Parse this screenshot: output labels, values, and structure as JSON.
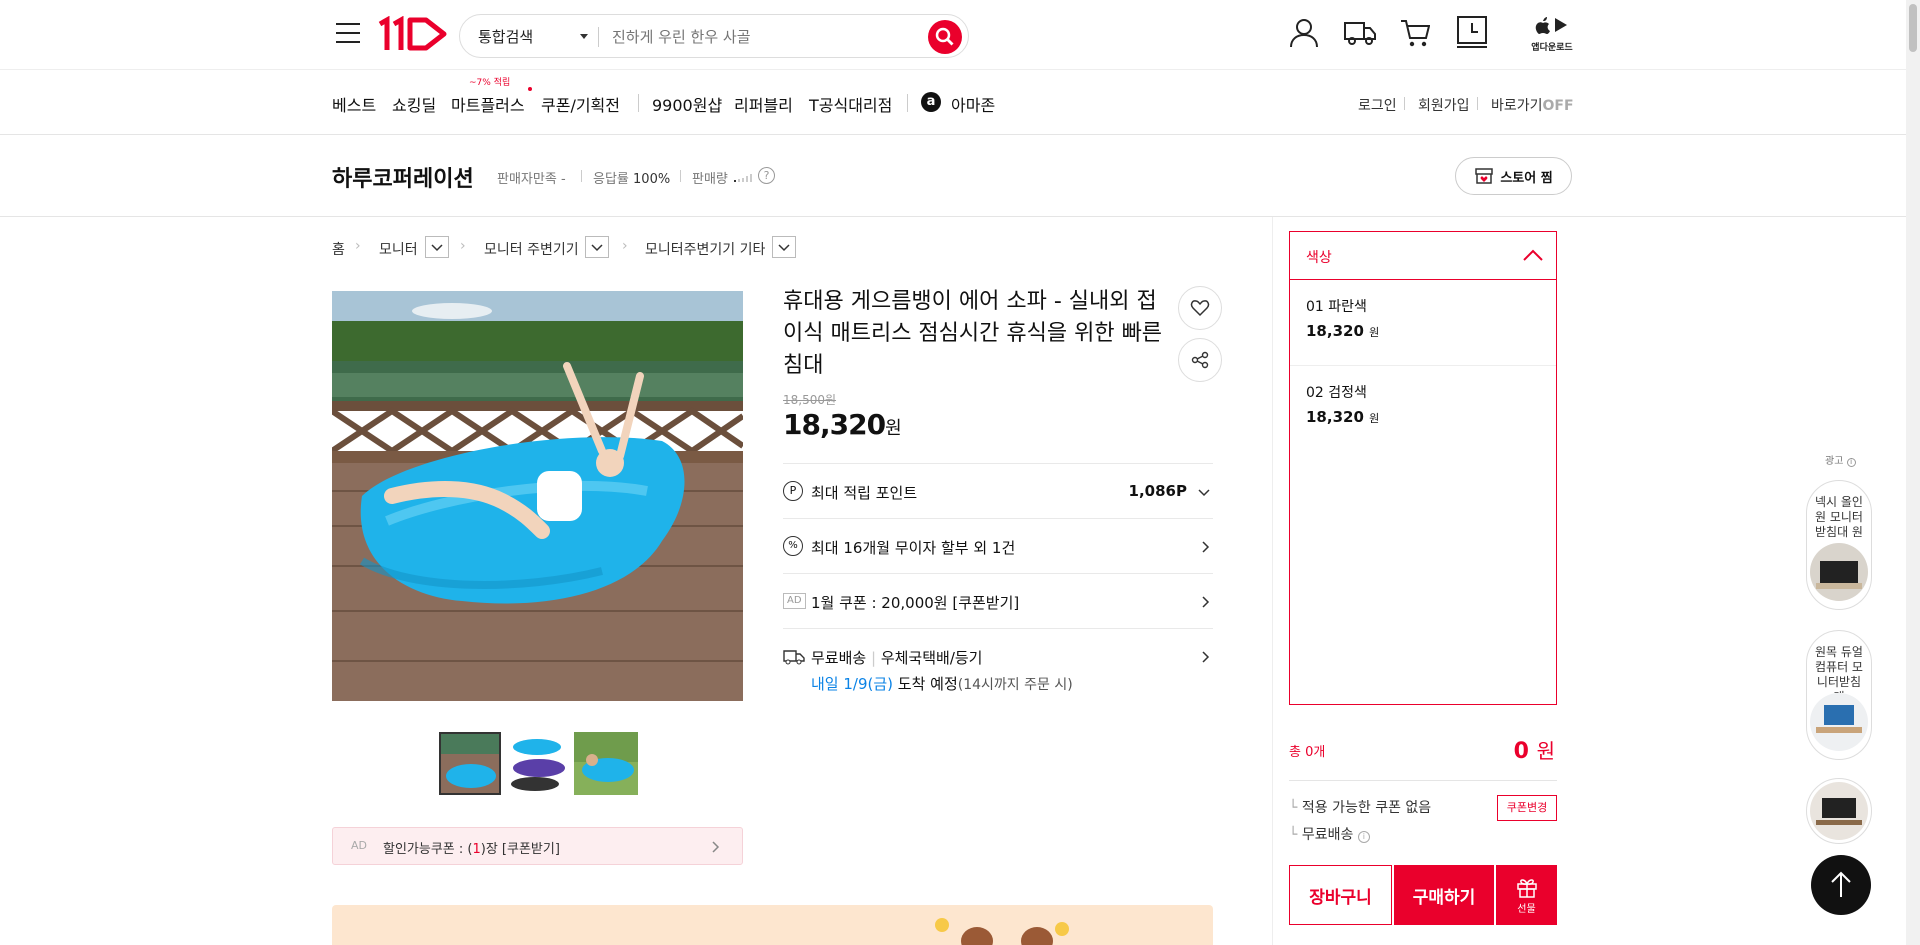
{
  "header": {
    "logo": "11",
    "search_scope": "통합검색",
    "search_placeholder": "진하게 우린 한우 사골",
    "app_download": "앱다운로드"
  },
  "nav": {
    "items": [
      "베스트",
      "쇼킹딜",
      "마트플러스",
      "쿠폰/기획전",
      "9900원샵",
      "리퍼블리",
      "T공식대리점",
      "아마존"
    ],
    "mart_badge": "~7% 적립",
    "right": {
      "login": "로그인",
      "join": "회원가입",
      "shortcut": "바로가기",
      "shortcut_state": "OFF"
    }
  },
  "seller": {
    "name": "하루코퍼레이션",
    "satisfaction_label": "판매자만족",
    "satisfaction_value": "-",
    "response_label": "응답률",
    "response_value": "100%",
    "sales_label": "판매량",
    "store_button": "스토어 찜"
  },
  "breadcrumb": [
    "홈",
    "모니터",
    "모니터 주변기기",
    "모니터주변기기 기타"
  ],
  "product": {
    "title": "휴대용 게으름뱅이 에어 소파 - 실내외 접이식 매트리스 점심시간 휴식을 위한 빠른 침대",
    "original_price": "18,500원",
    "price": "18,320",
    "price_unit": "원",
    "points_label": "최대 적립 포인트",
    "points_value": "1,086P",
    "installment": "최대 16개월 무이자 할부 외 1건",
    "ad_tag": "AD",
    "coupon_row": "1월 쿠폰 : 20,000원 [쿠폰받기]",
    "shipping_free": "무료배송",
    "shipping_method": "우체국택배/등기",
    "arrival_date": "내일 1/9(금)",
    "arrival_text": "도착 예정",
    "arrival_note": "(14시까지 주문 시)",
    "discount_coupon": "할인가능쿠폰 : (1)장 [쿠폰받기]",
    "discount_count": "1"
  },
  "options": {
    "header": "색상",
    "items": [
      {
        "name": "01 파란색",
        "price": "18,320",
        "unit": "원"
      },
      {
        "name": "02 검정색",
        "price": "18,320",
        "unit": "원"
      }
    ]
  },
  "order": {
    "total_label": "총 0개",
    "total_price": "0",
    "total_unit": "원",
    "coupon_none": "적용 가능한 쿠폰 없음",
    "coupon_change": "쿠폰변경",
    "free_shipping": "무료배송",
    "cart_button": "장바구니",
    "buy_button": "구매하기",
    "gift_button": "선물"
  },
  "wing": {
    "ad_label": "광고",
    "ads": [
      "넥시 올인원 모니터 받침대 원",
      "원목 듀얼 컴퓨터 모니터받침대"
    ]
  },
  "colors": {
    "accent": "#ea002c",
    "blue": "#0b83e6",
    "pool": "#1fb3ea"
  }
}
